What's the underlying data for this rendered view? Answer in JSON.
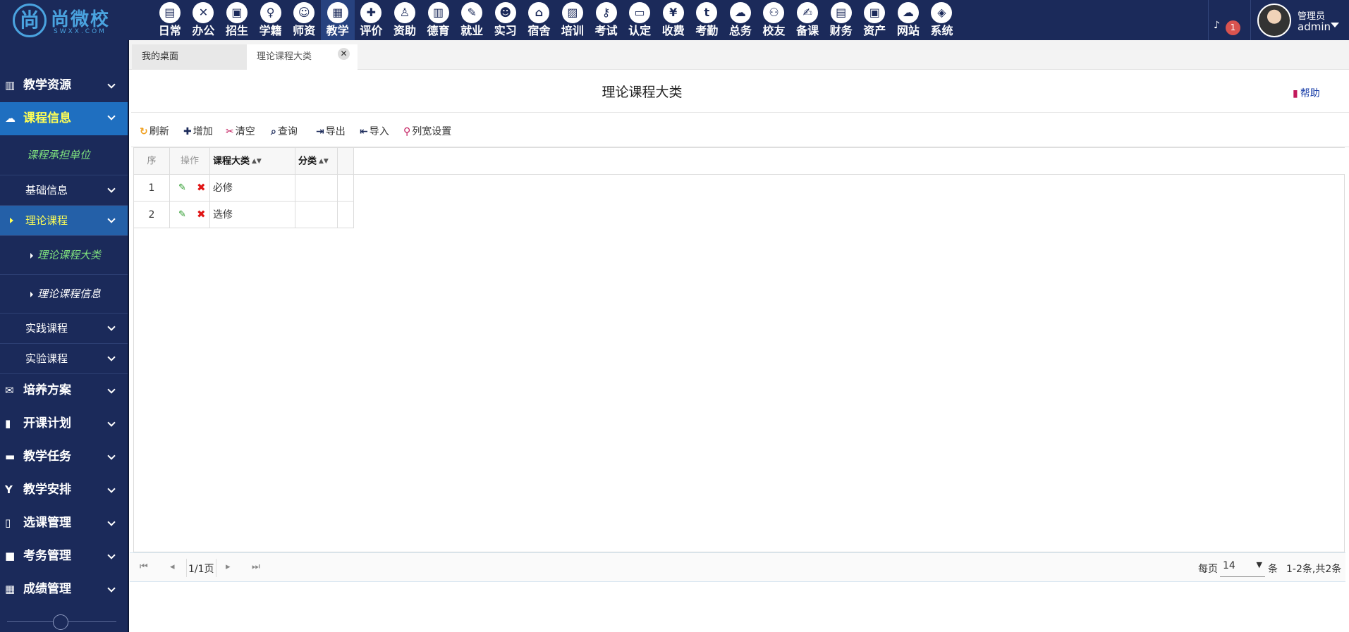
{
  "logo": {
    "mark": "尚",
    "name": "尚微校",
    "sub": "SWXX.COM"
  },
  "modules": [
    {
      "label": "日常",
      "icon": "clipboard-icon",
      "glyph": "▤"
    },
    {
      "label": "办公",
      "icon": "xing-icon",
      "glyph": "✕"
    },
    {
      "label": "招生",
      "icon": "bus-icon",
      "glyph": "▣"
    },
    {
      "label": "学籍",
      "icon": "child-icon",
      "glyph": "♀"
    },
    {
      "label": "师资",
      "icon": "teacher-icon",
      "glyph": "☺"
    },
    {
      "label": "教学",
      "icon": "calendar-icon",
      "glyph": "▦"
    },
    {
      "label": "评价",
      "icon": "calendar-plus-icon",
      "glyph": "✚"
    },
    {
      "label": "资助",
      "icon": "student-icon",
      "glyph": "♙"
    },
    {
      "label": "德育",
      "icon": "book-icon",
      "glyph": "▥"
    },
    {
      "label": "就业",
      "icon": "gavel-icon",
      "glyph": "✎"
    },
    {
      "label": "实习",
      "icon": "snapchat-icon",
      "glyph": "☻"
    },
    {
      "label": "宿舍",
      "icon": "home-icon",
      "glyph": "⌂"
    },
    {
      "label": "培训",
      "icon": "image-file-icon",
      "glyph": "▨"
    },
    {
      "label": "考试",
      "icon": "key-icon",
      "glyph": "⚷"
    },
    {
      "label": "认定",
      "icon": "desktop-icon",
      "glyph": "▭"
    },
    {
      "label": "收费",
      "icon": "yen-icon",
      "glyph": "¥"
    },
    {
      "label": "考勤",
      "icon": "tumblr-icon",
      "glyph": "t"
    },
    {
      "label": "总务",
      "icon": "cloud-chart-icon",
      "glyph": "☁"
    },
    {
      "label": "校友",
      "icon": "users-icon",
      "glyph": "⚇"
    },
    {
      "label": "备课",
      "icon": "edit-icon",
      "glyph": "✍"
    },
    {
      "label": "财务",
      "icon": "newspaper-icon",
      "glyph": "▤"
    },
    {
      "label": "资产",
      "icon": "train-icon",
      "glyph": "▣"
    },
    {
      "label": "网站",
      "icon": "cloud-icon",
      "glyph": "☁"
    },
    {
      "label": "系统",
      "icon": "cube-icon",
      "glyph": "◈"
    }
  ],
  "active_module": "教学",
  "notifications": {
    "count": "1"
  },
  "user": {
    "role": "管理员",
    "name": "admin"
  },
  "sidebar": {
    "sections": [
      {
        "label": "教学资源",
        "icon": "book-icon",
        "glyph": "▥"
      },
      {
        "label": "课程信息",
        "icon": "cloud-icon",
        "glyph": "☁"
      },
      {
        "label": "培养方案",
        "icon": "envelope-icon",
        "glyph": "✉"
      },
      {
        "label": "开课计划",
        "icon": "file-icon",
        "glyph": "▮"
      },
      {
        "label": "教学任务",
        "icon": "folder-icon",
        "glyph": "▬"
      },
      {
        "label": "教学安排",
        "icon": "yahoo-icon",
        "glyph": "Y"
      },
      {
        "label": "选课管理",
        "icon": "columns-icon",
        "glyph": "▯"
      },
      {
        "label": "考务管理",
        "icon": "square-icon",
        "glyph": "■"
      },
      {
        "label": "成绩管理",
        "icon": "th-large-icon",
        "glyph": "▦"
      }
    ],
    "course_info_children": {
      "unit": "课程承担单位",
      "basic": "基础信息",
      "theory": "理论课程",
      "theory_category": "理论课程大类",
      "theory_info": "理论课程信息",
      "practice": "实践课程",
      "lab": "实验课程"
    }
  },
  "tabs": {
    "desk": "我的桌面",
    "current": "理论课程大类",
    "close": "✕"
  },
  "page": {
    "title": "理论课程大类",
    "help": "帮助"
  },
  "toolbar": {
    "refresh": "刷新",
    "add": "增加",
    "clear": "清空",
    "query": "查询",
    "export": "导出",
    "import": "导入",
    "colwidth": "列宽设置"
  },
  "table": {
    "headers": {
      "seq": "序",
      "ops": "操作",
      "category": "课程大类",
      "type": "分类"
    },
    "rows": [
      {
        "seq": "1",
        "category": "必修",
        "type": ""
      },
      {
        "seq": "2",
        "category": "选修",
        "type": ""
      }
    ]
  },
  "pager": {
    "page_info": "1/1页",
    "per_page_label": "每页",
    "per_page": "14",
    "unit": "条",
    "summary": "1-2条,共2条"
  }
}
